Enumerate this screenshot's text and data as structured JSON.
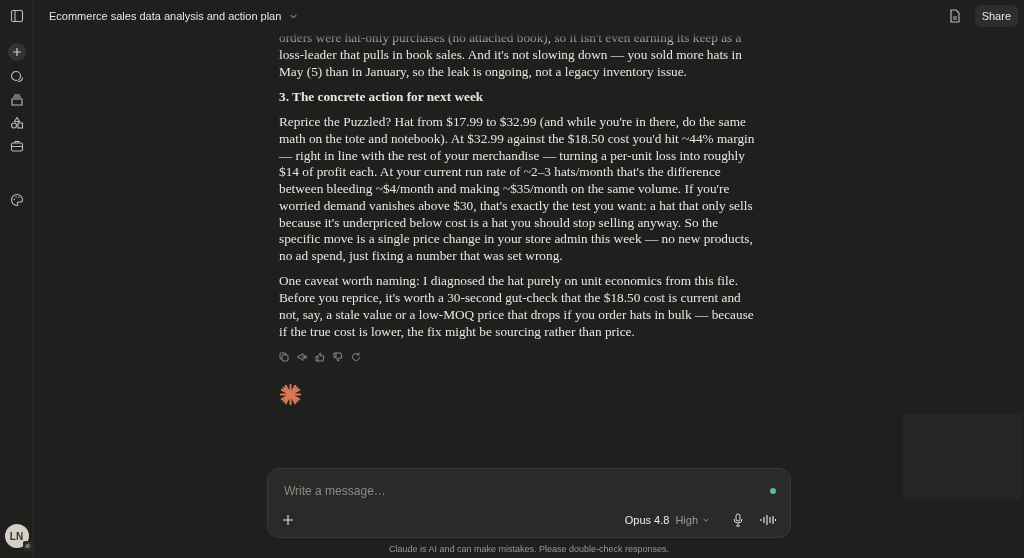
{
  "header": {
    "title": "Ecommerce sales data analysis and action plan",
    "share": "Share"
  },
  "message": [
    {
      "kind": "paragraph",
      "text": "orders were hat-only purchases (no attached book), so it isn't even earning its keep as a loss-leader that pulls in book sales. And it's not slowing down — you sold more hats in May (5) than in January, so the leak is ongoing, not a legacy inventory issue."
    },
    {
      "kind": "heading",
      "text": "3. The concrete action for next week"
    },
    {
      "kind": "paragraph",
      "text": "Reprice the Puzzled? Hat from $17.99 to $32.99 (and while you're in there, do the same math on the tote and notebook). At $32.99 against the $18.50 cost you'd hit ~44% margin — right in line with the rest of your merchandise — turning a per-unit loss into roughly $14 of profit each. At your current run rate of ~2–3 hats/month that's the difference between bleeding ~$4/month and making ~$35/month on the same volume. If you're worried demand vanishes above $30, that's exactly the test you want: a hat that only sells because it's underpriced below cost is a hat you should stop selling anyway. So the specific move is a single price change in your store admin this week — no new products, no ad spend, just fixing a number that was set wrong."
    },
    {
      "kind": "paragraph",
      "text": "One caveat worth naming: I diagnosed the hat purely on unit economics from this file. Before you reprice, it's worth a 30-second gut-check that the $18.50 cost is current and not, say, a stale value or a low-MOQ price that drops if you order hats in bulk — because if the true cost is lower, the fix might be sourcing rather than price."
    }
  ],
  "composer": {
    "placeholder": "Write a message…",
    "model": "Opus 4.8",
    "effort": "High"
  },
  "disclaimer": "Claude is AI and can make mistakes. Please double-check responses.",
  "user": {
    "initials": "LN"
  }
}
